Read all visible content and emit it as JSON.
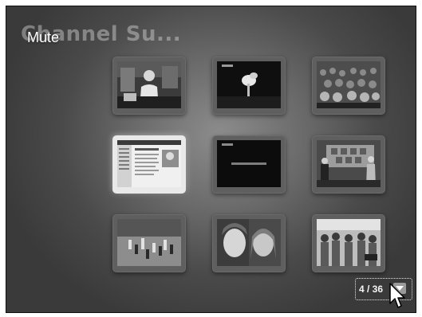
{
  "app": {
    "background_title": "Channel Su...",
    "status_label": "Mute"
  },
  "grid": {
    "selected_index": 3,
    "tiles": [
      {
        "name": "news-anchor",
        "icon": "news-anchor-thumbnail"
      },
      {
        "name": "night-fire",
        "icon": "night-explosion-thumbnail"
      },
      {
        "name": "crowd",
        "icon": "crowd-thumbnail"
      },
      {
        "name": "web-page",
        "icon": "web-page-thumbnail"
      },
      {
        "name": "story-of-movie",
        "icon": "movie-title-thumbnail"
      },
      {
        "name": "presenters",
        "icon": "presenters-thumbnail"
      },
      {
        "name": "basketball",
        "icon": "basketball-thumbnail"
      },
      {
        "name": "faces",
        "icon": "faces-thumbnail"
      },
      {
        "name": "street-crowd",
        "icon": "street-crowd-thumbnail"
      }
    ]
  },
  "pager": {
    "text": "4 / 36",
    "current": 4,
    "total": 36
  },
  "colors": {
    "background_center": "#8c8c8c",
    "background_edge": "#3a3a3a",
    "tile_frame": "#5f5f5f",
    "tile_selected": "#e9e9e9"
  }
}
